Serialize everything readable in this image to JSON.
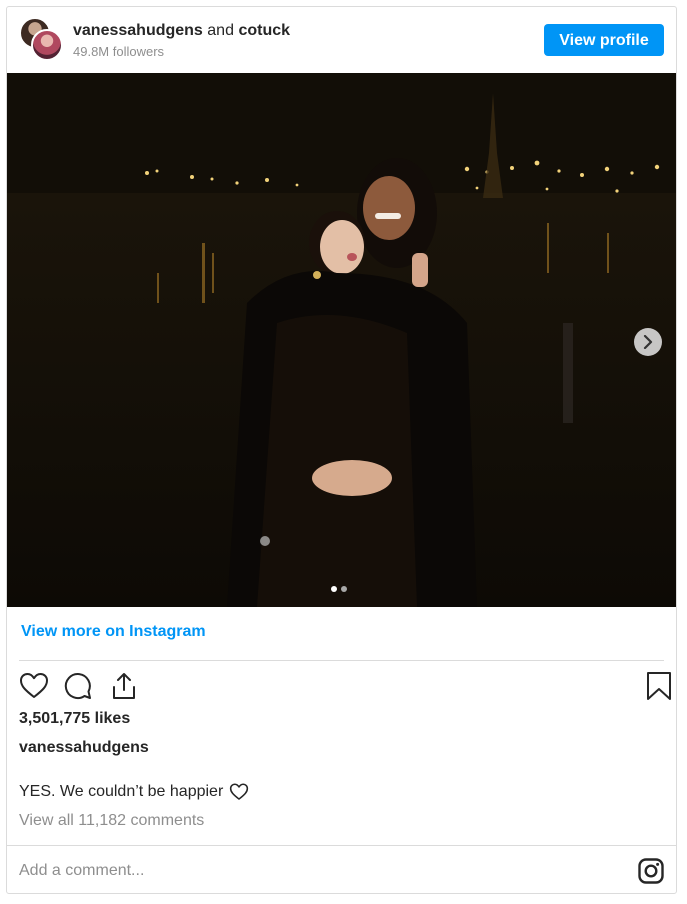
{
  "header": {
    "username": "vanessahudgens",
    "joiner": "and",
    "coauthor": "cotuck",
    "followers": "49.8M followers",
    "view_profile_label": "View profile"
  },
  "post": {
    "image_alt": "Couple embracing at night by the river with city lights",
    "carousel_total": 2,
    "carousel_active": 1
  },
  "links": {
    "view_more": "View more on Instagram"
  },
  "stats": {
    "likes": "3,501,775 likes"
  },
  "caption": {
    "username": "vanessahudgens",
    "text": "YES. We couldn’t be happier"
  },
  "comments": {
    "view_all": "View all 11,182 comments",
    "placeholder": "Add a comment..."
  },
  "icons": {
    "like": "heart-icon",
    "comment": "comment-bubble-icon",
    "share": "share-icon",
    "save": "bookmark-icon",
    "caption_emoji": "heart-outline-icon",
    "brand": "instagram-icon",
    "carousel_next": "chevron-right-icon"
  },
  "colors": {
    "accent": "#0095f6",
    "text": "#262626",
    "muted": "#8e8e8e",
    "border": "#dbdbdb"
  }
}
